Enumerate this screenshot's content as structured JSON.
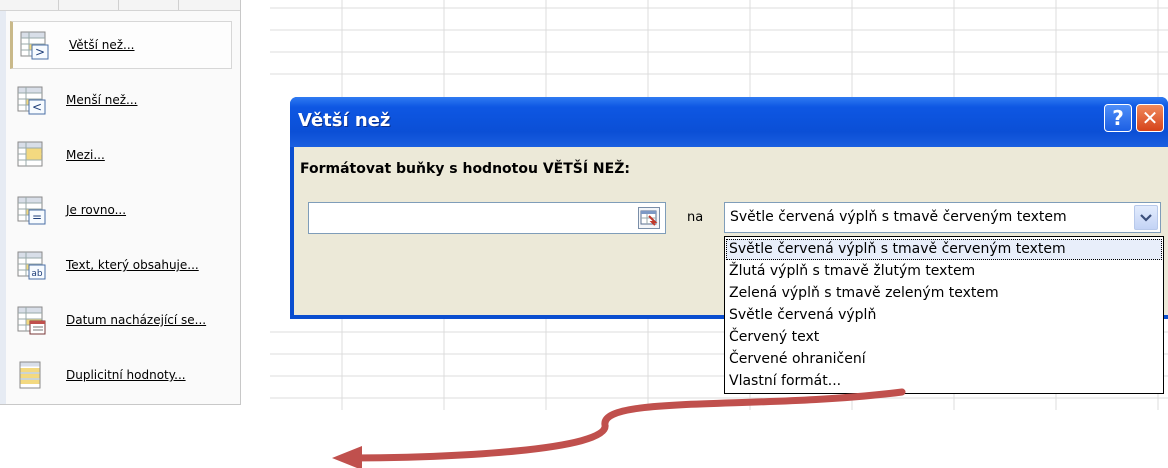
{
  "menu": {
    "items": [
      {
        "label": "Větší než...",
        "icon": "greater-than-icon",
        "selected": true
      },
      {
        "label": "Menší než...",
        "icon": "less-than-icon",
        "selected": false
      },
      {
        "label": "Mezi...",
        "icon": "between-icon",
        "selected": false
      },
      {
        "label": "Je rovno...",
        "icon": "equal-to-icon",
        "selected": false
      },
      {
        "label": "Text, který obsahuje...",
        "icon": "text-contains-icon",
        "selected": false
      },
      {
        "label": "Datum nacházející se...",
        "icon": "date-occurring-icon",
        "selected": false
      },
      {
        "label": "Duplicitní hodnoty...",
        "icon": "duplicate-values-icon",
        "selected": false
      }
    ]
  },
  "dialog": {
    "title": "Větší než",
    "help_glyph": "?",
    "close_glyph": "✕",
    "prompt": "Formátovat buňky s hodnotou VĚTŠÍ NEŽ:",
    "value_input": "",
    "with_label": "na",
    "selected_format": "Světle červená výplň s tmavě červeným textem"
  },
  "dropdown": {
    "options": [
      "Světle červená výplň s tmavě červeným textem",
      "Žlutá výplň s tmavě žlutým textem",
      "Zelená výplň s tmavě zeleným textem",
      "Světle červená výplň",
      "Červený text",
      "Červené ohraničení",
      "Vlastní formát..."
    ],
    "highlighted_index": 0
  },
  "colors": {
    "titlebar": "#0b4fd6",
    "dialog_face": "#ece9d8",
    "close_button": "#d6431a",
    "arrow": "#c0504d"
  }
}
